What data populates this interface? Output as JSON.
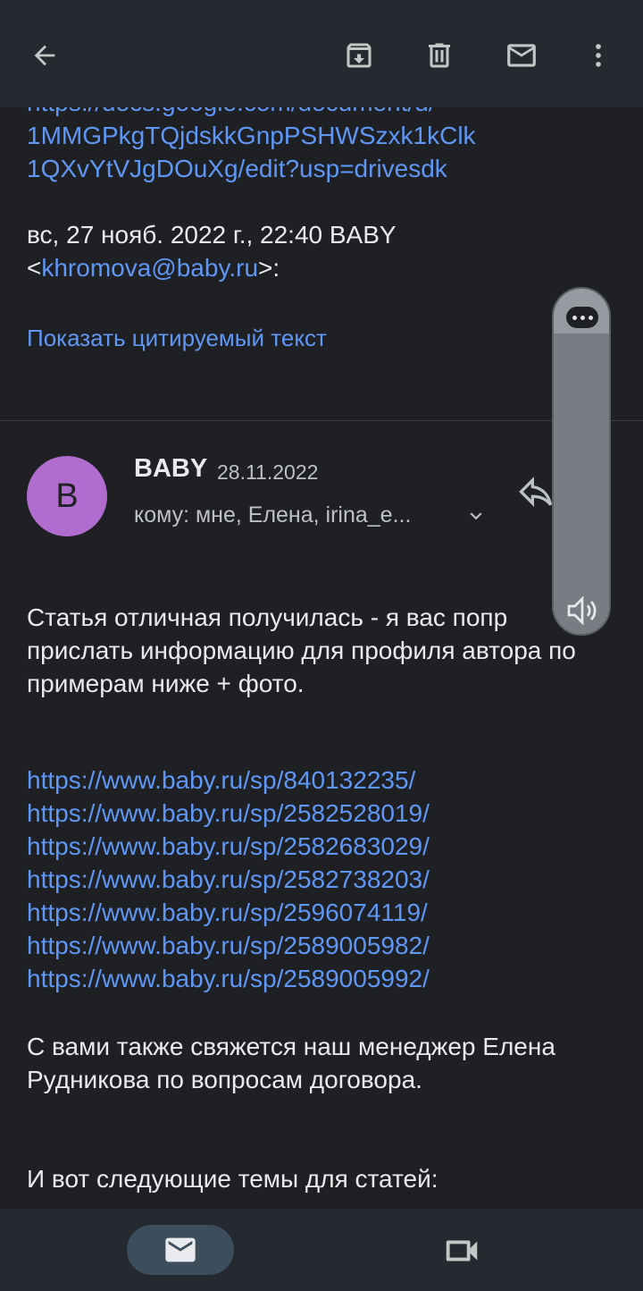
{
  "toolbar": {
    "back_icon": "arrow-left-icon",
    "archive_icon": "archive-icon",
    "delete_icon": "trash-icon",
    "mark_unread_icon": "mail-icon",
    "more_icon": "more-vertical-icon"
  },
  "previous_message": {
    "link_lines": [
      "https://docs.google.com/document/d/",
      "1MMGPkgTQjdskkGnpPSHWSzxk1kClk",
      "1QXvYtVJgDOuXg/edit?usp=drivesdk"
    ],
    "quote_header_prefix": "вс, 27 нояб. 2022 г., 22:40 BABY",
    "quote_header_open": "<",
    "quote_email": "khromova@baby.ru",
    "quote_header_close": ">:",
    "show_quoted_text": "Показать цитируемый текст"
  },
  "message": {
    "avatar_letter": "B",
    "sender": "BABY",
    "date": "28.11.2022",
    "recipients": "кому: мне, Елена, irina_e...",
    "paragraph1": "Статья отличная получилась - я вас попр прислать информацию для профиля автора по примерам ниже + фото.",
    "links": [
      "https://www.baby.ru/sp/840132235/",
      "https://www.baby.ru/sp/2582528019/",
      "https://www.baby.ru/sp/2582683029/",
      "https://www.baby.ru/sp/2582738203/",
      "https://www.baby.ru/sp/2596074119/",
      "https://www.baby.ru/sp/2589005982/",
      "https://www.baby.ru/sp/2589005992/"
    ],
    "paragraph2": "С вами также свяжется наш менеджер Елена Рудникова по вопросам договора.",
    "paragraph3": "И вот следующие темы для статей:"
  },
  "volume_panel": {
    "level_percent": 87,
    "icon": "speaker-icon"
  },
  "bottom_nav": {
    "mail_icon": "mail-icon",
    "meet_icon": "video-camera-icon"
  },
  "colors": {
    "background": "#1f2023",
    "bar": "#242a30",
    "link": "#5e97f6",
    "avatar": "#b06ccf"
  }
}
